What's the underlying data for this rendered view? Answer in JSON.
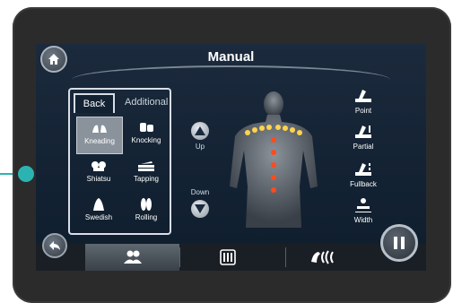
{
  "header": {
    "title": "Manual"
  },
  "tabs": [
    {
      "label": "Back",
      "selected": true
    },
    {
      "label": "Additional",
      "selected": false
    }
  ],
  "techniques": [
    {
      "label": "Kneading",
      "icon": "kneading-hands-icon",
      "selected": true
    },
    {
      "label": "Knocking",
      "icon": "knocking-hands-icon",
      "selected": false
    },
    {
      "label": "Shiatsu",
      "icon": "shiatsu-hands-icon",
      "selected": false
    },
    {
      "label": "Tapping",
      "icon": "tapping-hands-icon",
      "selected": false
    },
    {
      "label": "Swedish",
      "icon": "swedish-hand-icon",
      "selected": false
    },
    {
      "label": "Rolling",
      "icon": "rolling-feet-icon",
      "selected": false
    }
  ],
  "position": {
    "up_label": "Up",
    "down_label": "Down"
  },
  "modes": [
    {
      "label": "Point",
      "icon": "point-mode-icon"
    },
    {
      "label": "Partial",
      "icon": "partial-mode-icon"
    },
    {
      "label": "Fullback",
      "icon": "fullback-mode-icon"
    },
    {
      "label": "Width",
      "icon": "width-mode-icon"
    }
  ],
  "bottom_nav": [
    {
      "icon": "users-icon",
      "selected": true
    },
    {
      "icon": "roller-grid-icon",
      "selected": false
    },
    {
      "icon": "air-massage-icon",
      "selected": false
    }
  ],
  "colors": {
    "accent": "#2bb3b1",
    "screen_bg": "#132233",
    "shoulder_lights": "#ffd34d",
    "spine_lights": "#ff4a1e"
  }
}
